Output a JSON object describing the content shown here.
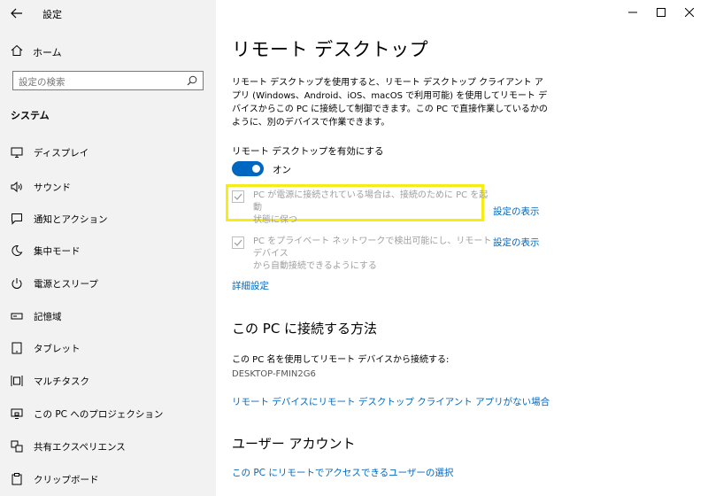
{
  "window": {
    "title": "設定"
  },
  "sidebar": {
    "home_label": "ホーム",
    "search_placeholder": "設定の検索",
    "section": "システム",
    "items": [
      {
        "label": "ディスプレイ",
        "icon": "display-icon"
      },
      {
        "label": "サウンド",
        "icon": "sound-icon"
      },
      {
        "label": "通知とアクション",
        "icon": "notification-icon"
      },
      {
        "label": "集中モード",
        "icon": "moon-icon"
      },
      {
        "label": "電源とスリープ",
        "icon": "power-icon"
      },
      {
        "label": "記憶域",
        "icon": "storage-icon"
      },
      {
        "label": "タブレット",
        "icon": "tablet-icon"
      },
      {
        "label": "マルチタスク",
        "icon": "multitask-icon"
      },
      {
        "label": "この PC へのプロジェクション",
        "icon": "projection-icon"
      },
      {
        "label": "共有エクスペリエンス",
        "icon": "share-icon"
      },
      {
        "label": "クリップボード",
        "icon": "clipboard-icon"
      }
    ]
  },
  "main": {
    "title": "リモート デスクトップ",
    "description": "リモート デスクトップを使用すると、リモート デスクトップ クライアント アプリ (Windows、Android、iOS、macOS で利用可能) を使用してリモート デバイスからこの PC に接続して制御できます。この PC で直接作業しているかのように、別のデバイスで作業できます。",
    "enable_label": "リモート デスクトップを有効にする",
    "toggle_state": "オン",
    "checkbox1": {
      "line1": "PC が電源に接続されている場合は、接続のために PC を起動",
      "line2": "状態に保つ",
      "link": "設定の表示"
    },
    "checkbox2": {
      "line1": "PC をプライベート ネットワークで検出可能にし、リモート デバイス",
      "line2": "から自動接続できるようにする",
      "link": "設定の表示"
    },
    "advanced_link": "詳細設定",
    "connect_heading": "この PC に接続する方法",
    "connect_text": "この PC 名を使用してリモート デバイスから接続する:",
    "pc_name": "DESKTOP-FMIN2G6",
    "no_client_link": "リモート デバイスにリモート デスクトップ クライアント アプリがない場合",
    "user_heading": "ユーザー アカウント",
    "user_link": "この PC にリモートでアクセスできるユーザーの選択"
  },
  "colors": {
    "accent": "#0067c0",
    "highlight": "#f5ec18",
    "sidebar_bg": "#f2f2f2"
  }
}
